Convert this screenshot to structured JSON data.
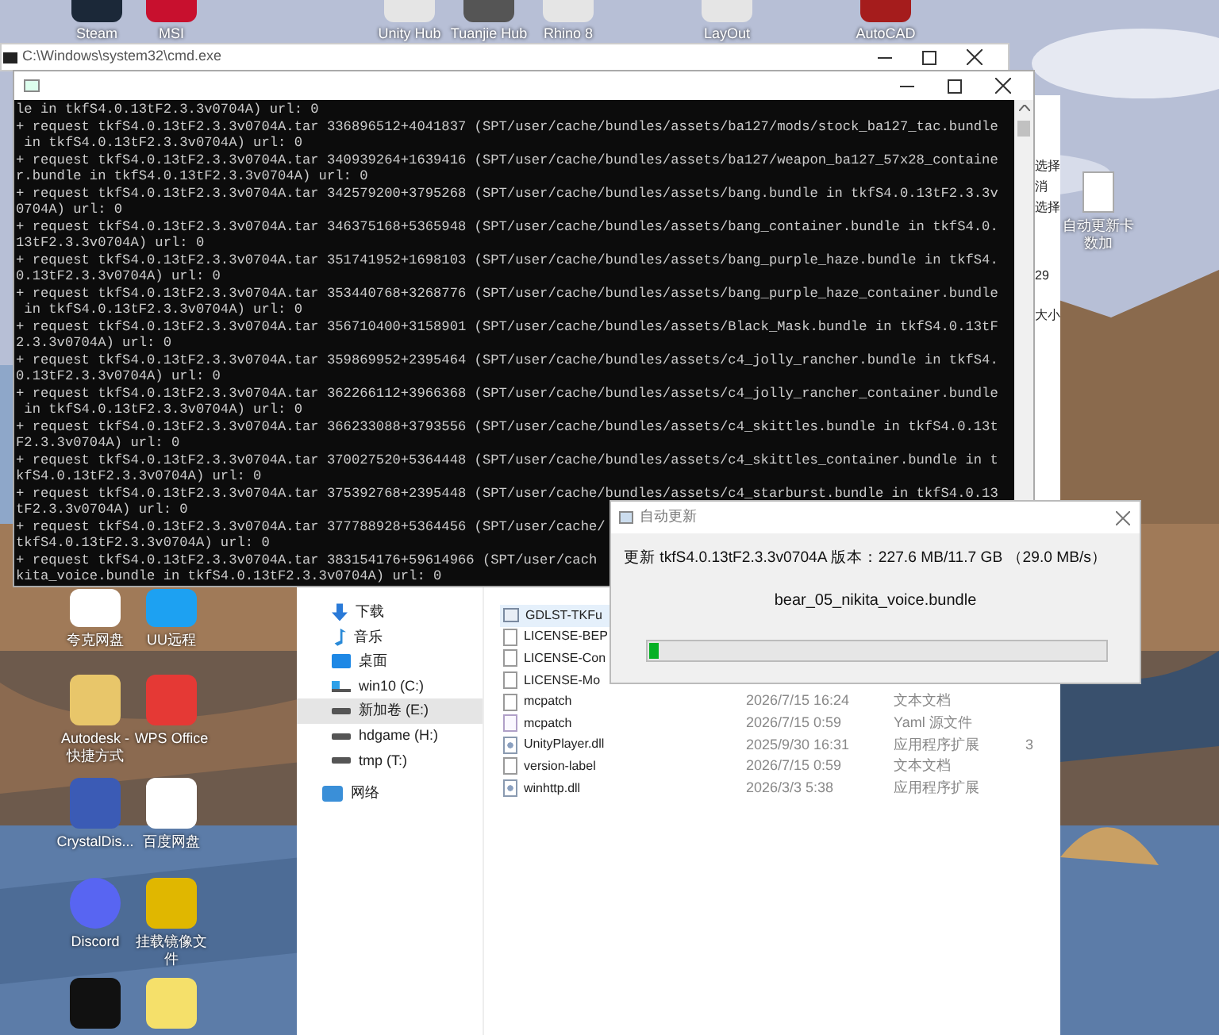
{
  "desktop_top": [
    {
      "label": "Steam"
    },
    {
      "label": "MSI"
    },
    {
      "label": "Unity Hub"
    },
    {
      "label": "Tuanjie Hub"
    },
    {
      "label": "Rhino 8"
    },
    {
      "label": "LayOut"
    },
    {
      "label": "AutoCAD"
    }
  ],
  "desktop_left": [
    {
      "label": "夸克网盘"
    },
    {
      "label": "UU远程"
    },
    {
      "label": "Autodesk - 快捷方式"
    },
    {
      "label": "WPS Office"
    },
    {
      "label": "CrystalDis..."
    },
    {
      "label": "百度网盘"
    },
    {
      "label": "Discord"
    },
    {
      "label": "挂载镜像文件"
    }
  ],
  "desktop_right": [
    {
      "label": "自动更新卡数加"
    }
  ],
  "back_window": {
    "title": "C:\\Windows\\system32\\cmd.exe"
  },
  "console": {
    "lines": [
      "le in tkfS4.0.13tF2.3.3v0704A) url: 0",
      "+ request tkfS4.0.13tF2.3.3v0704A.tar 336896512+4041837 (SPT/user/cache/bundles/assets/ba127/mods/stock_ba127_tac.bundle",
      " in tkfS4.0.13tF2.3.3v0704A) url: 0",
      "+ request tkfS4.0.13tF2.3.3v0704A.tar 340939264+1639416 (SPT/user/cache/bundles/assets/ba127/weapon_ba127_57x28_containe",
      "r.bundle in tkfS4.0.13tF2.3.3v0704A) url: 0",
      "+ request tkfS4.0.13tF2.3.3v0704A.tar 342579200+3795268 (SPT/user/cache/bundles/assets/bang.bundle in tkfS4.0.13tF2.3.3v",
      "0704A) url: 0",
      "+ request tkfS4.0.13tF2.3.3v0704A.tar 346375168+5365948 (SPT/user/cache/bundles/assets/bang_container.bundle in tkfS4.0.",
      "13tF2.3.3v0704A) url: 0",
      "+ request tkfS4.0.13tF2.3.3v0704A.tar 351741952+1698103 (SPT/user/cache/bundles/assets/bang_purple_haze.bundle in tkfS4.",
      "0.13tF2.3.3v0704A) url: 0",
      "+ request tkfS4.0.13tF2.3.3v0704A.tar 353440768+3268776 (SPT/user/cache/bundles/assets/bang_purple_haze_container.bundle",
      " in tkfS4.0.13tF2.3.3v0704A) url: 0",
      "+ request tkfS4.0.13tF2.3.3v0704A.tar 356710400+3158901 (SPT/user/cache/bundles/assets/Black_Mask.bundle in tkfS4.0.13tF",
      "2.3.3v0704A) url: 0",
      "+ request tkfS4.0.13tF2.3.3v0704A.tar 359869952+2395464 (SPT/user/cache/bundles/assets/c4_jolly_rancher.bundle in tkfS4.",
      "0.13tF2.3.3v0704A) url: 0",
      "+ request tkfS4.0.13tF2.3.3v0704A.tar 362266112+3966368 (SPT/user/cache/bundles/assets/c4_jolly_rancher_container.bundle",
      " in tkfS4.0.13tF2.3.3v0704A) url: 0",
      "+ request tkfS4.0.13tF2.3.3v0704A.tar 366233088+3793556 (SPT/user/cache/bundles/assets/c4_skittles.bundle in tkfS4.0.13t",
      "F2.3.3v0704A) url: 0",
      "+ request tkfS4.0.13tF2.3.3v0704A.tar 370027520+5364448 (SPT/user/cache/bundles/assets/c4_skittles_container.bundle in t",
      "kfS4.0.13tF2.3.3v0704A) url: 0",
      "+ request tkfS4.0.13tF2.3.3v0704A.tar 375392768+2395448 (SPT/user/cache/bundles/assets/c4_starburst.bundle in tkfS4.0.13",
      "tF2.3.3v0704A) url: 0",
      "+ request tkfS4.0.13tF2.3.3v0704A.tar 377788928+5364456 (SPT/user/cache/",
      "tkfS4.0.13tF2.3.3v0704A) url: 0",
      "+ request tkfS4.0.13tF2.3.3v0704A.tar 383154176+59614966 (SPT/user/cach",
      "kita_voice.bundle in tkfS4.0.13tF2.3.3v0704A) url: 0"
    ]
  },
  "explorer": {
    "ribbon_fragments": [
      "选择",
      "消",
      "选择",
      "29",
      "大小"
    ],
    "nav": [
      {
        "label": "下载",
        "kind": "download",
        "selected": false
      },
      {
        "label": "音乐",
        "kind": "music",
        "selected": false
      },
      {
        "label": "桌面",
        "kind": "desktop",
        "selected": false
      },
      {
        "label": "win10 (C:)",
        "kind": "system_drive",
        "selected": false
      },
      {
        "label": "新加卷 (E:)",
        "kind": "drive",
        "selected": true
      },
      {
        "label": "hdgame (H:)",
        "kind": "drive",
        "selected": false
      },
      {
        "label": "tmp (T:)",
        "kind": "drive",
        "selected": false
      },
      {
        "label": "网络",
        "kind": "network",
        "selected": false
      }
    ],
    "files": [
      {
        "name": "GDLST-TKFu",
        "kind": "config",
        "selected": true
      },
      {
        "name": "LICENSE-BEP",
        "kind": "text",
        "selected": false
      },
      {
        "name": "LICENSE-Con",
        "kind": "text",
        "selected": false
      },
      {
        "name": "LICENSE-Mo",
        "kind": "text",
        "selected": false
      },
      {
        "name": "mcpatch",
        "date": "2026/7/15 16:24",
        "type": "文本文档",
        "kind": "text",
        "selected": false
      },
      {
        "name": "mcpatch",
        "date": "2026/7/15 0:59",
        "type": "Yaml 源文件",
        "kind": "yaml",
        "selected": false
      },
      {
        "name": "UnityPlayer.dll",
        "date": "2025/9/30 16:31",
        "type": "应用程序扩展",
        "size": "3",
        "kind": "dll",
        "selected": false
      },
      {
        "name": "version-label",
        "date": "2026/7/15 0:59",
        "type": "文本文档",
        "kind": "text",
        "selected": false
      },
      {
        "name": "winhttp.dll",
        "date": "2026/3/3 5:38",
        "type": "应用程序扩展",
        "kind": "dll",
        "selected": false
      }
    ]
  },
  "dialog": {
    "title": "自动更新",
    "status": "更新 tkfS4.0.13tF2.3.3v0704A 版本：227.6 MB/11.7 GB （29.0 MB/s）",
    "file": "bear_05_nikita_voice.bundle",
    "level": 0.02
  }
}
